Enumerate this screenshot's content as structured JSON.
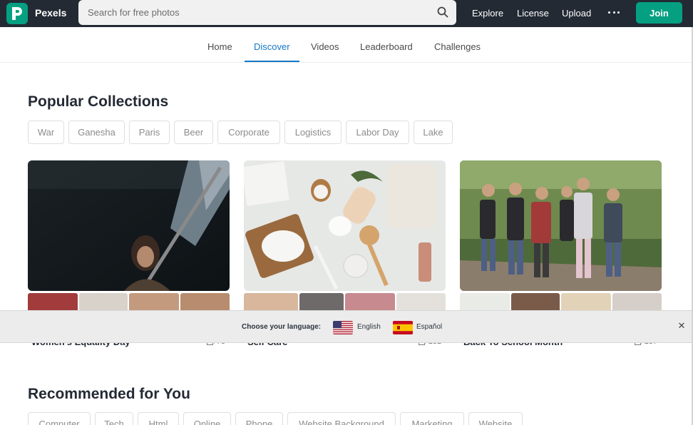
{
  "header": {
    "brand": "Pexels",
    "search_placeholder": "Search for free photos",
    "nav": [
      "Explore",
      "License",
      "Upload"
    ],
    "join_label": "Join"
  },
  "tabs": [
    "Home",
    "Discover",
    "Videos",
    "Leaderboard",
    "Challenges"
  ],
  "active_tab": "Discover",
  "popular": {
    "title": "Popular Collections",
    "tags": [
      "War",
      "Ganesha",
      "Paris",
      "Beer",
      "Corporate",
      "Logistics",
      "Labor Day",
      "Lake"
    ],
    "collections": [
      {
        "name": "Women's Equality Day",
        "count": "73"
      },
      {
        "name": "Self Care",
        "count": "131"
      },
      {
        "name": "Back To School Month",
        "count": "137"
      }
    ]
  },
  "language_banner": {
    "prompt": "Choose your language:",
    "options": [
      "English",
      "Español"
    ]
  },
  "recommended": {
    "title": "Recommended for You",
    "tags": [
      "Computer",
      "Tech",
      "Html",
      "Online",
      "Phone",
      "Website Background",
      "Marketing",
      "Website"
    ]
  },
  "colors": {
    "topbar": "#232a34",
    "brand_green": "#05a081",
    "active_tab": "#1677c6",
    "banner": "#ececec"
  }
}
